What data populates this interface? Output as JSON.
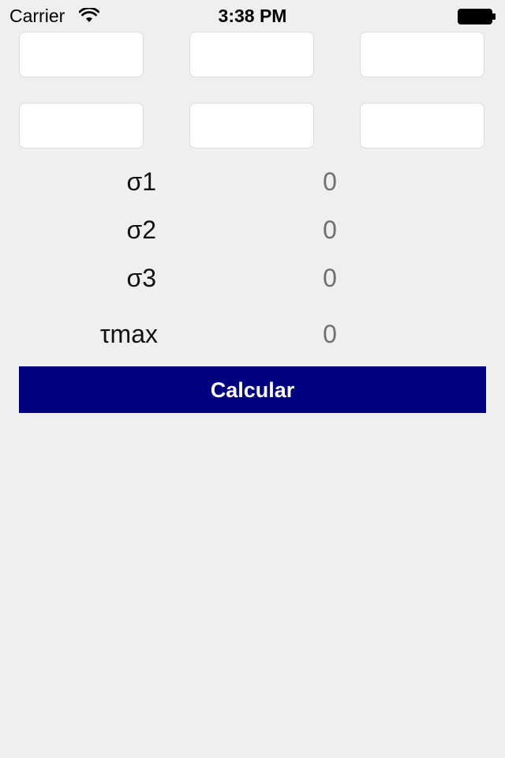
{
  "status_bar": {
    "carrier": "Carrier",
    "time": "3:38 PM",
    "wifi_icon": "wifi-icon",
    "battery_icon": "battery-icon"
  },
  "inputs": [
    {
      "value": "",
      "placeholder": ""
    },
    {
      "value": "",
      "placeholder": ""
    },
    {
      "value": "",
      "placeholder": ""
    },
    {
      "value": "",
      "placeholder": ""
    },
    {
      "value": "",
      "placeholder": ""
    },
    {
      "value": "",
      "placeholder": ""
    }
  ],
  "results": [
    {
      "label": "σ1",
      "value": "0"
    },
    {
      "label": "σ2",
      "value": "0"
    },
    {
      "label": "σ3",
      "value": "0"
    },
    {
      "label": "τmax",
      "value": "0"
    }
  ],
  "button": {
    "label": "Calcular"
  },
  "colors": {
    "background": "#efefef",
    "button": "#000080",
    "button_text": "#ffffff",
    "value_text": "#6f6f6f"
  }
}
